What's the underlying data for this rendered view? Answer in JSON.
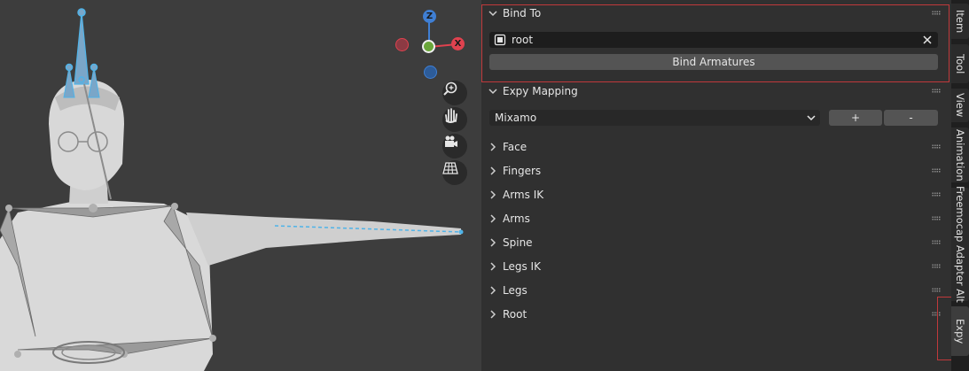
{
  "panel": {
    "bind_to": {
      "header": "Bind To",
      "field_value": "root",
      "button_label": "Bind Armatures"
    },
    "expy_mapping": {
      "header": "Expy Mapping",
      "preset_value": "Mixamo",
      "add_label": "+",
      "remove_label": "-"
    },
    "subpanels": [
      "Face",
      "Fingers",
      "Arms IK",
      "Arms",
      "Spine",
      "Legs IK",
      "Legs",
      "Root"
    ]
  },
  "tabs": [
    "Item",
    "Tool",
    "View",
    "Animation",
    "Freemocap Adapter Alt",
    "Expy"
  ],
  "active_tab": "Expy",
  "gizmo": {
    "z_label": "Z",
    "x_label": "X"
  },
  "colors": {
    "axis_x": "#e0424f",
    "axis_y": "#7cbb2d",
    "axis_z": "#3f7fd4",
    "bone_highlight": "#4fb3e8",
    "annotation_red": "#c0393b"
  }
}
